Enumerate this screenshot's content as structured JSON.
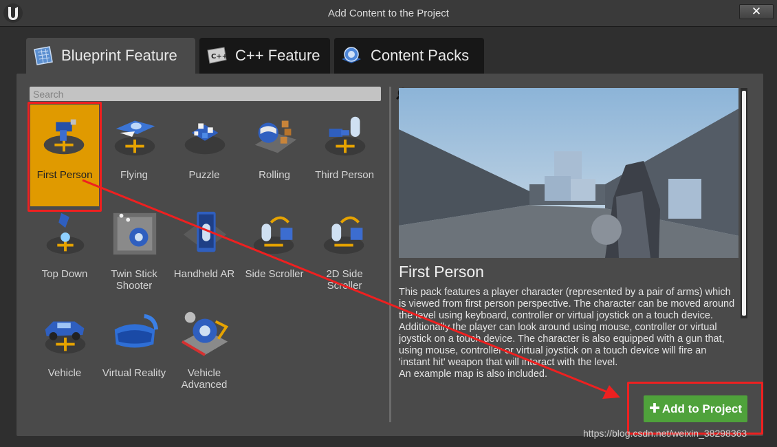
{
  "window": {
    "title": "Add Content to the Project",
    "close_label": "✕"
  },
  "tabs": [
    {
      "label": "Blueprint Feature",
      "active": true
    },
    {
      "label": "C++ Feature",
      "active": false
    },
    {
      "label": "Content Packs",
      "active": false
    }
  ],
  "search": {
    "placeholder": "Search",
    "value": ""
  },
  "templates": [
    {
      "label": "First Person",
      "selected": true
    },
    {
      "label": "Flying"
    },
    {
      "label": "Puzzle"
    },
    {
      "label": "Rolling"
    },
    {
      "label": "Third Person"
    },
    {
      "label": "Top Down"
    },
    {
      "label": "Twin Stick Shooter"
    },
    {
      "label": "Handheld AR"
    },
    {
      "label": "Side Scroller"
    },
    {
      "label": "2D Side Scroller"
    },
    {
      "label": "Vehicle"
    },
    {
      "label": "Virtual Reality"
    },
    {
      "label": "Vehicle Advanced"
    }
  ],
  "details": {
    "title": "First Person",
    "description": "This pack features a player character (represented by a pair of arms) which is viewed from first person perspective. The character can be moved around the level using keyboard, controller or virtual joystick on a touch device. Additionally the player can look around using mouse, controller or virtual joystick on a touch device. The character is also equipped with a gun that, using mouse, controller or virtual joystick on a touch device will fire an 'instant hit' weapon that will interact with the level.",
    "description_extra": "An example map is also included."
  },
  "actions": {
    "add_label": "Add to Project"
  },
  "annotation_color": "#ee2020",
  "watermark": "https://blog.csdn.net/weixin_38298363"
}
